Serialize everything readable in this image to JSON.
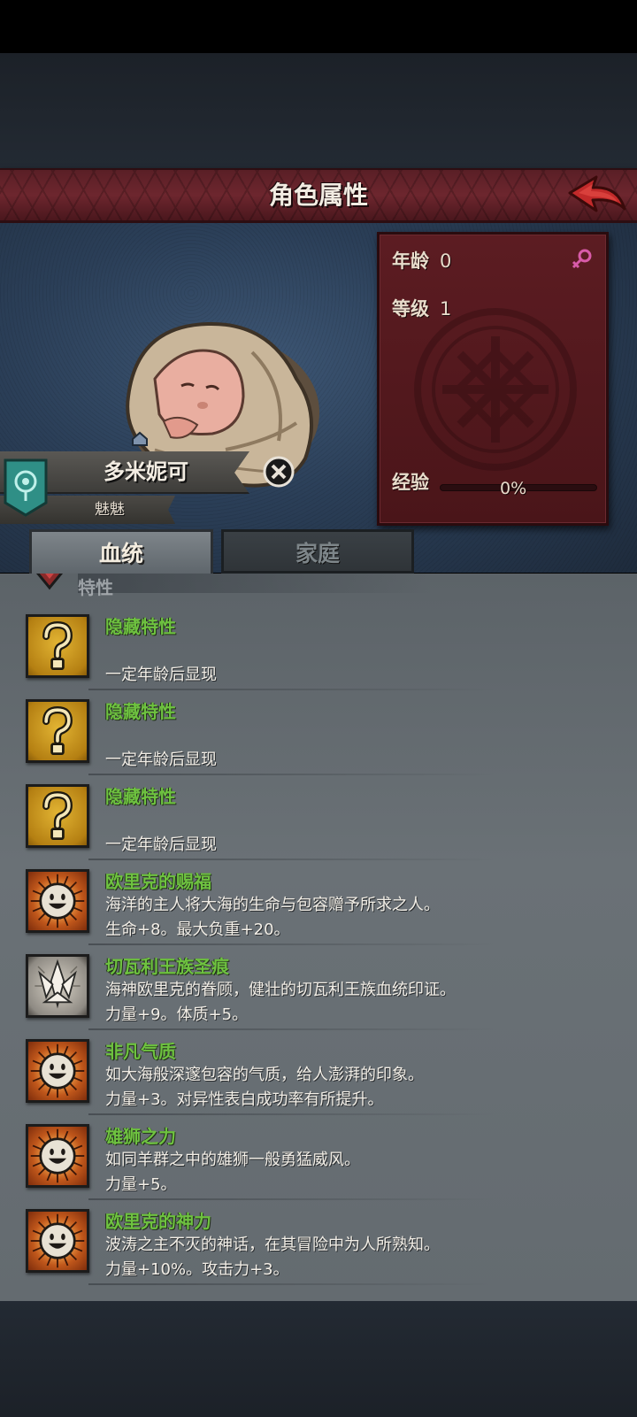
{
  "header": {
    "title": "角色属性"
  },
  "stats": {
    "age_label": "年龄",
    "age_value": "0",
    "level_label": "等级",
    "level_value": "1",
    "exp_label": "经验",
    "exp_value": "0%",
    "gender_icon": "female-symbol-icon",
    "exp_progress": 0
  },
  "character": {
    "name": "多米妮可",
    "title": "魅魅"
  },
  "tabs": [
    {
      "label": "血统",
      "active": true
    },
    {
      "label": "家庭",
      "active": false
    }
  ],
  "section": {
    "label": "特性"
  },
  "traits": [
    {
      "icon": "question-mark-icon",
      "name": "隐藏特性",
      "desc": "",
      "effect": "一定年龄后显现"
    },
    {
      "icon": "question-mark-icon",
      "name": "隐藏特性",
      "desc": "",
      "effect": "一定年龄后显现"
    },
    {
      "icon": "question-mark-icon",
      "name": "隐藏特性",
      "desc": "",
      "effect": "一定年龄后显现"
    },
    {
      "icon": "smiling-sun-icon",
      "name": "欧里克的赐福",
      "desc": "海洋的主人将大海的生命与包容赠予所求之人。",
      "effect": "生命+8。最大负重+20。"
    },
    {
      "icon": "crown-emblem-icon",
      "name": "切瓦利王族圣痕",
      "desc": "海神欧里克的眷顾，健壮的切瓦利王族血统印证。",
      "effect": "力量+9。体质+5。"
    },
    {
      "icon": "smiling-sun-icon",
      "name": "非凡气质",
      "desc": "如大海般深邃包容的气质，给人澎湃的印象。",
      "effect": "力量+3。对异性表白成功率有所提升。"
    },
    {
      "icon": "smiling-sun-icon",
      "name": "雄狮之力",
      "desc": "如同羊群之中的雄狮一般勇猛威风。",
      "effect": "力量+5。"
    },
    {
      "icon": "smiling-sun-icon",
      "name": "欧里克的神力",
      "desc": "波涛之主不灭的神话，在其冒险中为人所熟知。",
      "effect": "力量+10%。攻击力+3。"
    }
  ]
}
